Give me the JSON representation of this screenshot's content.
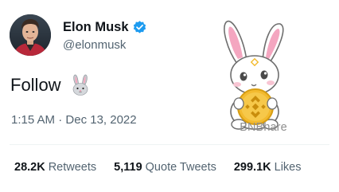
{
  "author": {
    "display_name": "Elon Musk",
    "username": "@elonmusk",
    "verified": true,
    "avatar_icon": "profile-avatar"
  },
  "tweet": {
    "text": "Follow",
    "emoji": "rabbit-face-emoji",
    "time": "1:15 AM",
    "separator": "·",
    "date": "Dec 13, 2022"
  },
  "watermark": {
    "text": "BNBhare",
    "icon": "bunny-holding-bnb-coin"
  },
  "stats": [
    {
      "value": "28.2K",
      "label": "Retweets"
    },
    {
      "value": "5,119",
      "label": "Quote Tweets"
    },
    {
      "value": "299.1K",
      "label": "Likes"
    }
  ],
  "colors": {
    "text_primary": "#0f1419",
    "text_secondary": "#536471",
    "verified_blue": "#1d9bf0",
    "bnb_gold": "#f3ba2f",
    "bunny_ear_pink": "#f4a6c0",
    "divider": "#eff3f4"
  }
}
